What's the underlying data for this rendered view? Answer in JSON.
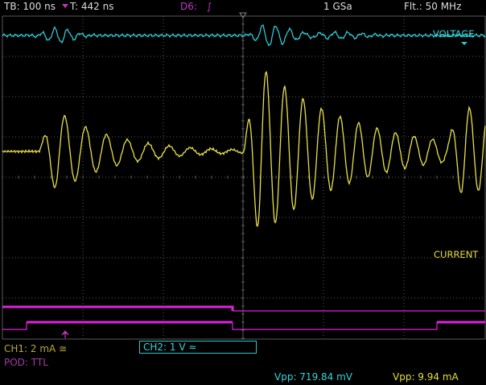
{
  "status_bar": {
    "timebase": "TB: 100 ns",
    "trigger_time": "T: 442 ns",
    "trigger_source": "D6:",
    "trigger_slope_symbol": "∫",
    "sample_rate": "1 GSa",
    "filter": "Flt.: 50 MHz"
  },
  "traces": {
    "voltage_label": "VOLTAGE",
    "current_label": "CURRENT"
  },
  "channels": {
    "ch1": "CH1: 2 mA ≅",
    "pod": "POD: TTL",
    "ch2": "CH2: 1 V ≈"
  },
  "measurements": {
    "vpp_voltage": "Vpp: 719.84 mV",
    "vpp_current": "Vpp: 9.94 mA"
  },
  "colors": {
    "voltage": "#2ec8d2",
    "current": "#e8e04a",
    "digital": "#e020e0",
    "grid": "#5a5a5a",
    "label_current": "#e5de3a",
    "trigger_marker": "#c03ac0"
  }
}
